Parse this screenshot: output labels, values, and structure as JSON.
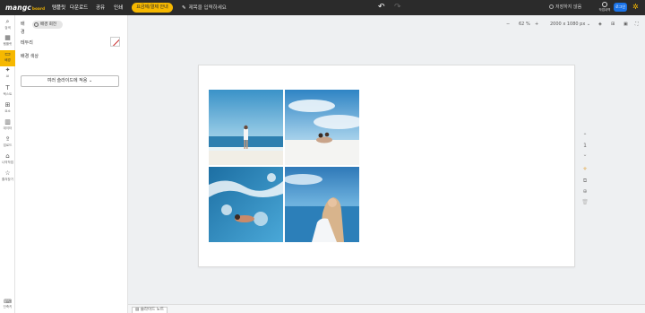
{
  "app": {
    "logo": "mangc",
    "logo_sub": "board",
    "menu": [
      "템플릿",
      "다운로드",
      "공유",
      "인쇄"
    ],
    "plan_button": "요금제/결제 안내",
    "title_placeholder": "제목을 입력하세요",
    "save_status": "저장하지 않음",
    "history_label": "작업내역",
    "login_label": "로그인"
  },
  "rail": {
    "items": [
      {
        "label": "검색",
        "icon": "search-icon"
      },
      {
        "label": "템플릿",
        "icon": "template-icon"
      },
      {
        "label": "배경",
        "icon": "background-icon"
      },
      {
        "label": "AI",
        "icon": "ai-icon"
      },
      {
        "label": "텍스트",
        "icon": "text-icon"
      },
      {
        "label": "요소",
        "icon": "elements-icon"
      },
      {
        "label": "데이터",
        "icon": "chart-icon"
      },
      {
        "label": "업로드",
        "icon": "upload-icon"
      },
      {
        "label": "나의작업",
        "icon": "folder-icon"
      },
      {
        "label": "즐겨찾기",
        "icon": "star-icon"
      }
    ],
    "bottom_label": "단축키"
  },
  "panel": {
    "tab_background": "배경",
    "tab_active": "배경 회전",
    "row_border": "테두리",
    "row_color": "배경 색상",
    "apply_button": "여러 슬라이드에 적용"
  },
  "toolbar": {
    "zoom": "62 %",
    "size": "2000 x 1080 px"
  },
  "footer": {
    "slide_note": "슬라이드 노트"
  },
  "colors": {
    "accent": "#f6b800",
    "topbar": "#2b2b2b"
  }
}
